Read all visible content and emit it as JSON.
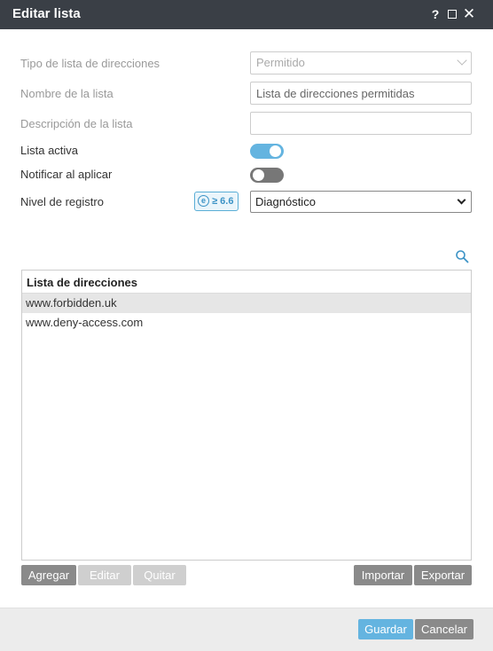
{
  "window": {
    "title": "Editar lista",
    "help_label": "?",
    "close_label": "✕"
  },
  "form": {
    "type_label": "Tipo de lista de direcciones",
    "type_value": "Permitido",
    "name_label": "Nombre de la lista",
    "name_value": "Lista de direcciones permitidas",
    "desc_label": "Descripción de la lista",
    "desc_value": "",
    "active_label": "Lista activa",
    "active_on": true,
    "notify_label": "Notificar al aplicar",
    "notify_on": false,
    "log_label": "Nivel de registro",
    "version_badge_icon": "e",
    "version_badge": "≥ 6.6",
    "log_value": "Diagnóstico"
  },
  "list": {
    "header": "Lista de direcciones",
    "items": [
      "www.forbidden.uk",
      "www.deny-access.com"
    ],
    "selected_index": 0
  },
  "list_buttons": {
    "add": "Agregar",
    "edit": "Editar",
    "remove": "Quitar",
    "import": "Importar",
    "export": "Exportar"
  },
  "footer": {
    "save": "Guardar",
    "cancel": "Cancelar"
  },
  "colors": {
    "titlebar": "#3a3f46",
    "accent": "#64b4e0",
    "button_gray": "#8a8a8a",
    "button_disabled": "#cfcfcf"
  },
  "icons": {
    "help": "help-icon",
    "maximize": "maximize-icon",
    "close": "close-icon",
    "search": "search-icon",
    "eset": "eset-logo-icon"
  }
}
